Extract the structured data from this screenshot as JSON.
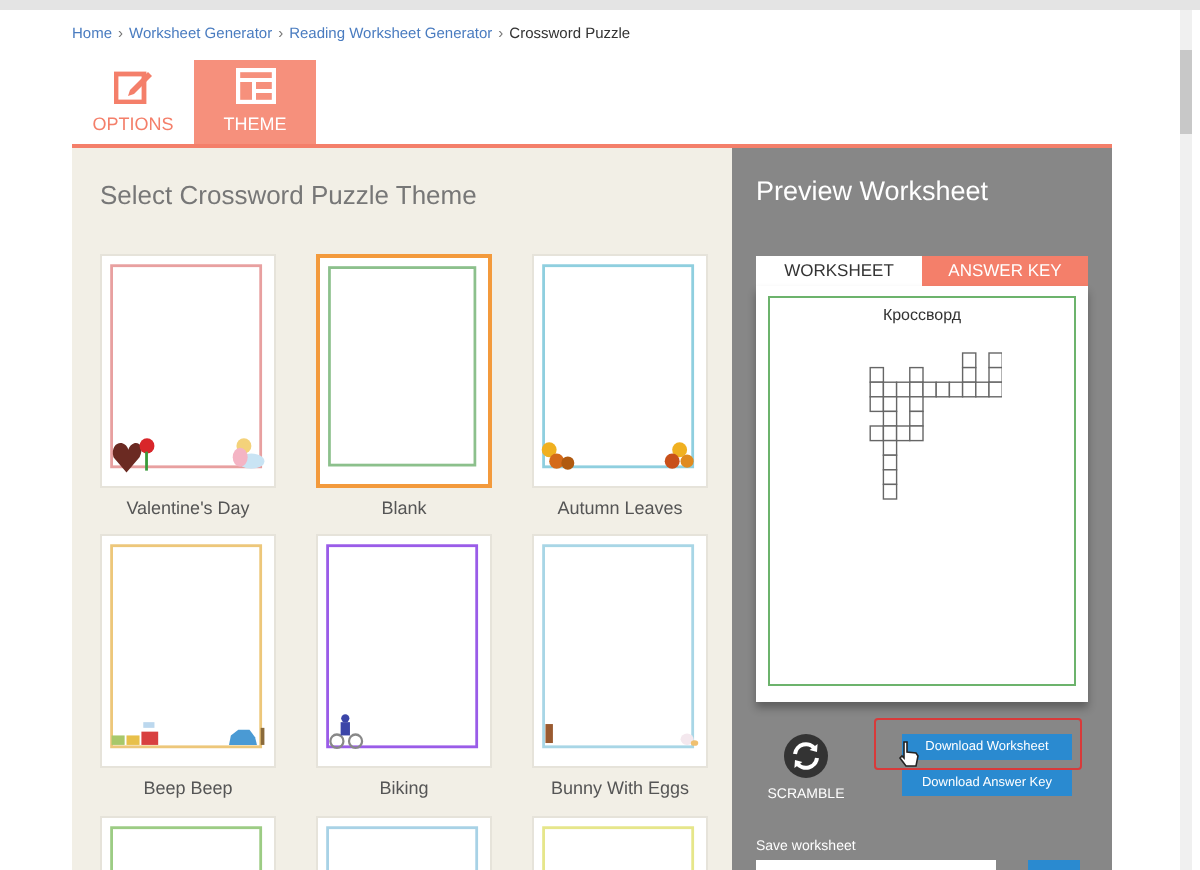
{
  "breadcrumb": [
    {
      "label": "Home",
      "link": true
    },
    {
      "label": "Worksheet Generator",
      "link": true
    },
    {
      "label": "Reading Worksheet Generator",
      "link": true
    },
    {
      "label": "Crossword Puzzle",
      "link": false
    }
  ],
  "breadcrumb_separator": "›",
  "tabs": [
    {
      "label": "OPTIONS",
      "kind": "edit",
      "selected": false
    },
    {
      "label": "THEME",
      "kind": "layout",
      "selected": true
    }
  ],
  "theme_panel": {
    "title": "Select Crossword Puzzle Theme",
    "themes": [
      {
        "label": "Valentine's Day",
        "color": "#e8a0a0",
        "kind": "hearts",
        "selected": false
      },
      {
        "label": "Blank",
        "color": "#8cc08c",
        "kind": "plain",
        "selected": true
      },
      {
        "label": "Autumn Leaves",
        "color": "#8fcfdf",
        "kind": "leaves",
        "selected": false
      },
      {
        "label": "Beep Beep",
        "color": "#edc77a",
        "kind": "cars",
        "selected": false
      },
      {
        "label": "Biking",
        "color": "#9a5ce8",
        "kind": "bike",
        "selected": false
      },
      {
        "label": "Bunny With Eggs",
        "color": "#a8d6e6",
        "kind": "bunny",
        "selected": false
      },
      {
        "color": "#9ccc84",
        "kind": "plain",
        "selected": false
      },
      {
        "color": "#a8d2e6",
        "kind": "plain",
        "selected": false
      },
      {
        "color": "#e6e68a",
        "kind": "plain",
        "selected": false
      }
    ]
  },
  "preview": {
    "title": "Preview Worksheet",
    "tabs": [
      {
        "label": "WORKSHEET",
        "selected": true
      },
      {
        "label": "ANSWER KEY",
        "selected": false
      }
    ],
    "worksheet_title": "Кроссворд",
    "scramble": "SCRAMBLE",
    "buttons": [
      {
        "label": "Download Worksheet",
        "highlighted": true
      },
      {
        "label": "Download Answer Key",
        "highlighted": false
      }
    ],
    "save_label": "Save worksheet"
  }
}
